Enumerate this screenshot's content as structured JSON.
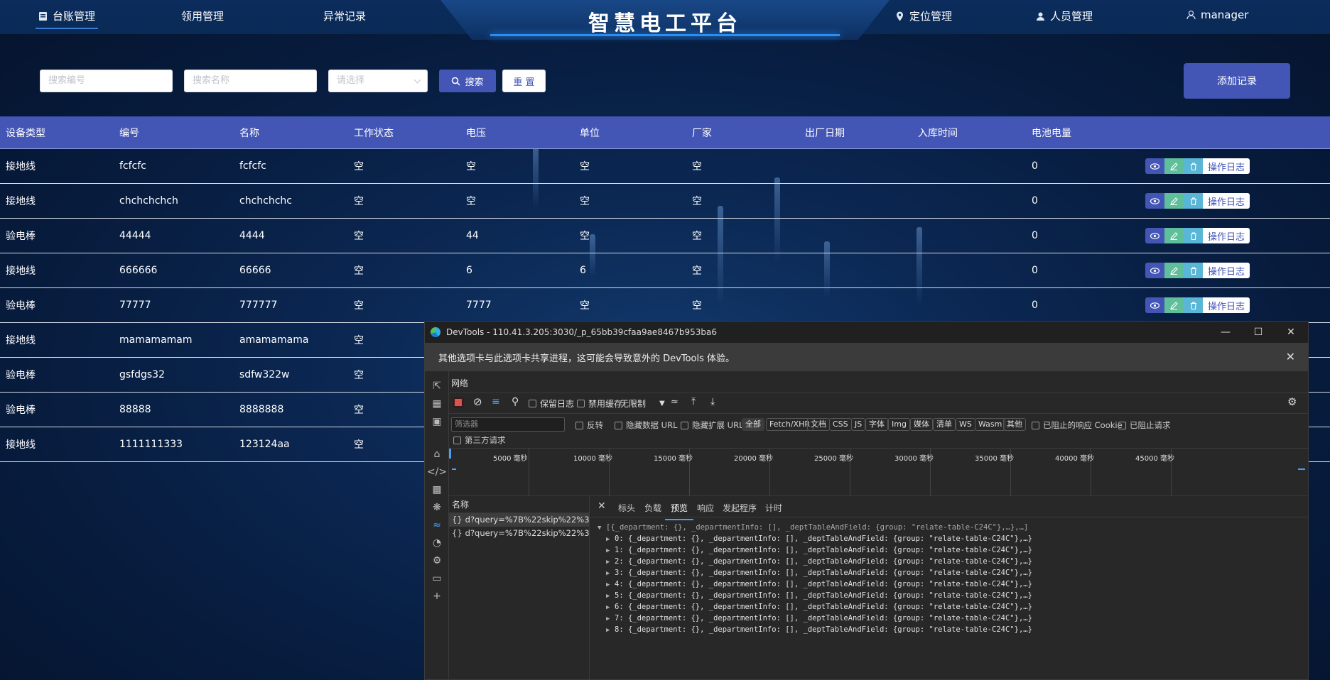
{
  "nav": {
    "left": [
      {
        "label": "台账管理",
        "active": true
      },
      {
        "label": "领用管理",
        "active": false
      },
      {
        "label": "异常记录",
        "active": false
      }
    ],
    "title": "智慧电工平台",
    "right": [
      {
        "label": "定位管理",
        "icon": "location-pin-icon"
      },
      {
        "label": "人员管理",
        "icon": "people-icon"
      },
      {
        "label": "manager",
        "icon": "user-icon"
      }
    ]
  },
  "search": {
    "code_placeholder": "搜索编号",
    "name_placeholder": "搜索名称",
    "select_placeholder": "请选择",
    "search_label": "搜索",
    "reset_label": "重 置",
    "add_label": "添加记录"
  },
  "table": {
    "columns": [
      "设备类型",
      "编号",
      "名称",
      "工作状态",
      "电压",
      "单位",
      "厂家",
      "出厂日期",
      "入库时间",
      "电池电量"
    ],
    "action_log_label": "操作日志",
    "rows": [
      {
        "type": "接地线",
        "code": "fcfcfc",
        "name": "fcfcfc",
        "status": "空",
        "voltage": "空",
        "unit": "空",
        "maker": "空",
        "mfg_date": "",
        "stock_time": "",
        "battery": "0",
        "ops": true
      },
      {
        "type": "接地线",
        "code": "chchchchch",
        "name": "chchchchc",
        "status": "空",
        "voltage": "空",
        "unit": "空",
        "maker": "空",
        "mfg_date": "",
        "stock_time": "",
        "battery": "0",
        "ops": true
      },
      {
        "type": "验电棒",
        "code": "44444",
        "name": "4444",
        "status": "空",
        "voltage": "44",
        "unit": "空",
        "maker": "空",
        "mfg_date": "",
        "stock_time": "",
        "battery": "0",
        "ops": true
      },
      {
        "type": "接地线",
        "code": "666666",
        "name": "66666",
        "status": "空",
        "voltage": "6",
        "unit": "6",
        "maker": "空",
        "mfg_date": "",
        "stock_time": "",
        "battery": "0",
        "ops": true
      },
      {
        "type": "验电棒",
        "code": "77777",
        "name": "777777",
        "status": "空",
        "voltage": "7777",
        "unit": "空",
        "maker": "空",
        "mfg_date": "",
        "stock_time": "",
        "battery": "0",
        "ops": true
      },
      {
        "type": "接地线",
        "code": "mamamamam",
        "name": "amamamama",
        "status": "空",
        "voltage": "",
        "unit": "",
        "maker": "",
        "mfg_date": "",
        "stock_time": "",
        "battery": "",
        "ops": false
      },
      {
        "type": "验电棒",
        "code": "gsfdgs32",
        "name": "sdfw322w",
        "status": "空",
        "voltage": "",
        "unit": "",
        "maker": "",
        "mfg_date": "",
        "stock_time": "",
        "battery": "",
        "ops": false
      },
      {
        "type": "验电棒",
        "code": "88888",
        "name": "8888888",
        "status": "空",
        "voltage": "",
        "unit": "",
        "maker": "",
        "mfg_date": "",
        "stock_time": "",
        "battery": "",
        "ops": false
      },
      {
        "type": "接地线",
        "code": "1111111333",
        "name": "123124aa",
        "status": "空",
        "voltage": "",
        "unit": "",
        "maker": "",
        "mfg_date": "",
        "stock_time": "",
        "battery": "",
        "ops": false
      }
    ]
  },
  "devtools": {
    "window_title": "DevTools - 110.41.3.205:3030/_p_65bb39cfaa9ae8467b953ba6",
    "warning": "其他选项卡与此选项卡共享进程，这可能会导致意外的 DevTools 体验。",
    "panel_title": "网络",
    "toolbar": {
      "preserve_log": "保留日志",
      "disable_cache": "禁用缓存",
      "throttle": "无限制"
    },
    "filter": {
      "placeholder": "筛选器",
      "invert": "反转",
      "hide_data_url": "隐藏数据 URL",
      "hide_ext_url": "隐藏扩展 URL",
      "types": [
        "全部",
        "Fetch/XHR",
        "文档",
        "CSS",
        "JS",
        "字体",
        "Img",
        "媒体",
        "清单",
        "WS",
        "Wasm",
        "其他"
      ],
      "blocked_cookies": "已阻止的响应 Cookie",
      "blocked_requests": "已阻止请求",
      "third_party": "第三方请求"
    },
    "timeline_ticks": [
      "5000 毫秒",
      "10000 毫秒",
      "15000 毫秒",
      "20000 毫秒",
      "25000 毫秒",
      "30000 毫秒",
      "35000 毫秒",
      "40000 毫秒",
      "45000 毫秒"
    ],
    "name_header": "名称",
    "requests": [
      "d?query=%7B%22skip%22%3...",
      "d?query=%7B%22skip%22%3..."
    ],
    "detail_tabs": [
      "标头",
      "负载",
      "预览",
      "响应",
      "发起程序",
      "计时"
    ],
    "active_tab": "预览",
    "preview_root": "[{_department: {}, _departmentInfo: [], _deptTableAndField: {group: \"relate-table-C24C\"},…},…]",
    "preview_items": [
      "0: {_department: {}, _departmentInfo: [], _deptTableAndField: {group: \"relate-table-C24C\"},…}",
      "1: {_department: {}, _departmentInfo: [], _deptTableAndField: {group: \"relate-table-C24C\"},…}",
      "2: {_department: {}, _departmentInfo: [], _deptTableAndField: {group: \"relate-table-C24C\"},…}",
      "3: {_department: {}, _departmentInfo: [], _deptTableAndField: {group: \"relate-table-C24C\"},…}",
      "4: {_department: {}, _departmentInfo: [], _deptTableAndField: {group: \"relate-table-C24C\"},…}",
      "5: {_department: {}, _departmentInfo: [], _deptTableAndField: {group: \"relate-table-C24C\"},…}",
      "6: {_department: {}, _departmentInfo: [], _deptTableAndField: {group: \"relate-table-C24C\"},…}",
      "7: {_department: {}, _departmentInfo: [], _deptTableAndField: {group: \"relate-table-C24C\"},…}",
      "8: {_department: {}, _departmentInfo: [], _deptTableAndField: {group: \"relate-table-C24C\"},…}"
    ]
  },
  "colors": {
    "primary": "#4356b5",
    "edit": "#5fbf9b",
    "delete": "#5ab6d6",
    "bg": "#0b2752"
  }
}
